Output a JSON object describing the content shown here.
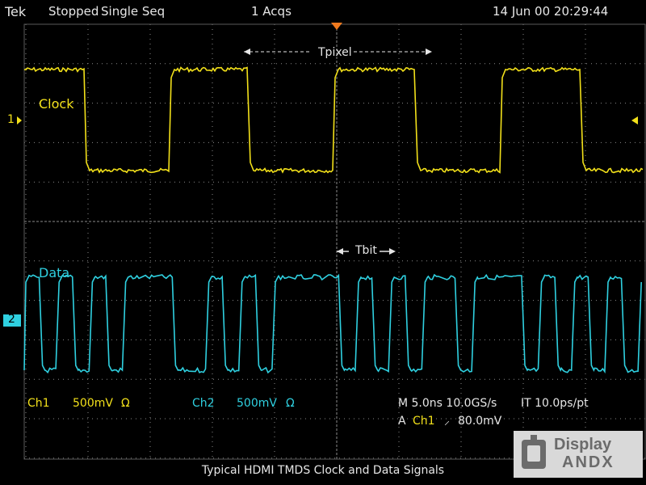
{
  "status": {
    "brand": "Tek",
    "state": "Stopped",
    "mode": "Single Seq",
    "acquisitions": "1 Acqs",
    "datetime": "14 Jun 00 20:29:44"
  },
  "traces": {
    "clock": {
      "label": "Clock",
      "marker": "1",
      "color": "#f2e01a"
    },
    "data": {
      "label": "Data",
      "marker": "2",
      "color": "#2fd0e0"
    }
  },
  "annotations": {
    "tpixel": "Tpixel",
    "tbit": "Tbit"
  },
  "readouts": {
    "ch1_name": "Ch1",
    "ch1_scale": "500mV",
    "ch1_coupling": "Ω",
    "ch2_name": "Ch2",
    "ch2_scale": "500mV",
    "ch2_coupling": "Ω",
    "timebase": "M 5.0ns 10.0GS/s",
    "interpolation": "IT 10.0ps/pt",
    "trigger_prefix": "A",
    "trigger_source": "Ch1",
    "trigger_slope": "⸝",
    "trigger_level": "80.0mV"
  },
  "caption": "Typical HDMI TMDS Clock and Data Signals",
  "logo": {
    "line1": "Display",
    "line2": "ANDX"
  },
  "clock_edges": [
    105,
    210,
    308,
    413,
    515,
    620,
    720
  ],
  "data_bits": [
    1,
    0,
    1,
    0,
    1,
    0,
    1,
    1,
    1,
    0,
    0,
    1,
    0,
    1,
    0,
    1,
    1,
    1,
    1,
    0,
    1,
    0,
    1,
    0,
    1,
    1,
    0,
    1,
    1,
    1,
    0,
    1,
    0,
    1,
    0,
    1,
    0,
    1
  ],
  "colors": {
    "grid": "#8a8a8a",
    "background": "#000000",
    "trigger": "#f07a1e"
  }
}
